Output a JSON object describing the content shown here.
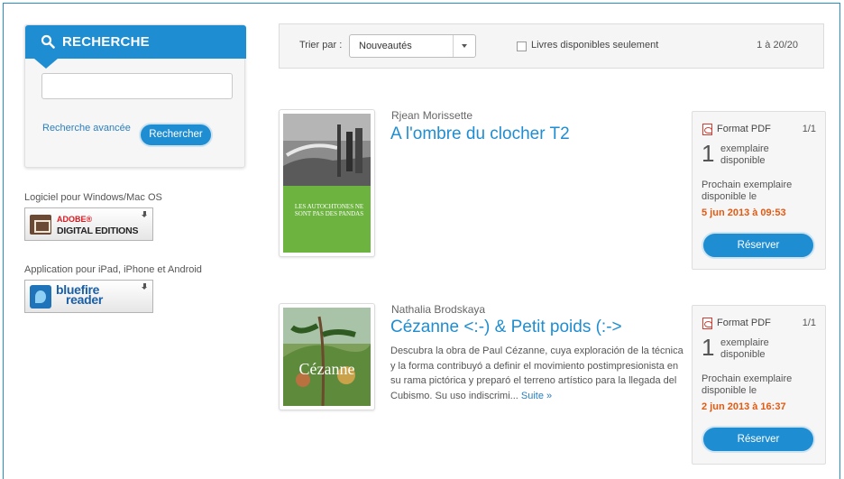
{
  "search": {
    "title": "RECHERCHE",
    "input_value": "",
    "advanced_link": "Recherche avancée",
    "button_label": "Rechercher"
  },
  "software": {
    "windows_label": "Logiciel pour Windows/Mac OS",
    "adobe_line1": "ADOBE®",
    "adobe_line2": "DIGITAL EDITIONS",
    "mobile_label": "Application pour iPad, iPhone et Android",
    "bluefire_line1": "bluefire",
    "bluefire_line2": "reader"
  },
  "toolbar": {
    "sort_label": "Trier par :",
    "sort_value": "Nouveautés",
    "available_only_label": "Livres disponibles seulement",
    "available_only_checked": false,
    "range": "1 à 20/20"
  },
  "books": [
    {
      "author": "Rjean Morissette",
      "title": "A l'ombre du clocher T2",
      "description": "",
      "more_link": "",
      "cover_text": "LES AUTOCHTONES NE SONT PAS DES PANDAS",
      "format": "Format PDF",
      "count": "1/1",
      "copies": "1",
      "copies_label": "exemplaire disponible",
      "next_label": "Prochain exemplaire disponible le",
      "next_date": "5 jun 2013 à 09:53",
      "reserve_label": "Réserver"
    },
    {
      "author": "Nathalia Brodskaya",
      "title": "Cézanne <:-) & Petit poids (:->",
      "description": "Descubra la obra de Paul Cézanne, cuya exploración de la técnica y la forma contribuyó a definir el movimiento postimpresionista en su rama pictórica y preparó el terreno artístico para la llegada del Cubismo. Su uso indiscrimi...",
      "more_link": "Suite »",
      "cover_text": "Cézanne",
      "format": "Format PDF",
      "count": "1/1",
      "copies": "1",
      "copies_label": "exemplaire disponible",
      "next_label": "Prochain exemplaire disponible le",
      "next_date": "2 jun 2013 à 16:37",
      "reserve_label": "Réserver"
    }
  ],
  "colors": {
    "accent": "#1f8dd1",
    "date": "#e25a12",
    "frame": "#2a8cc4"
  }
}
